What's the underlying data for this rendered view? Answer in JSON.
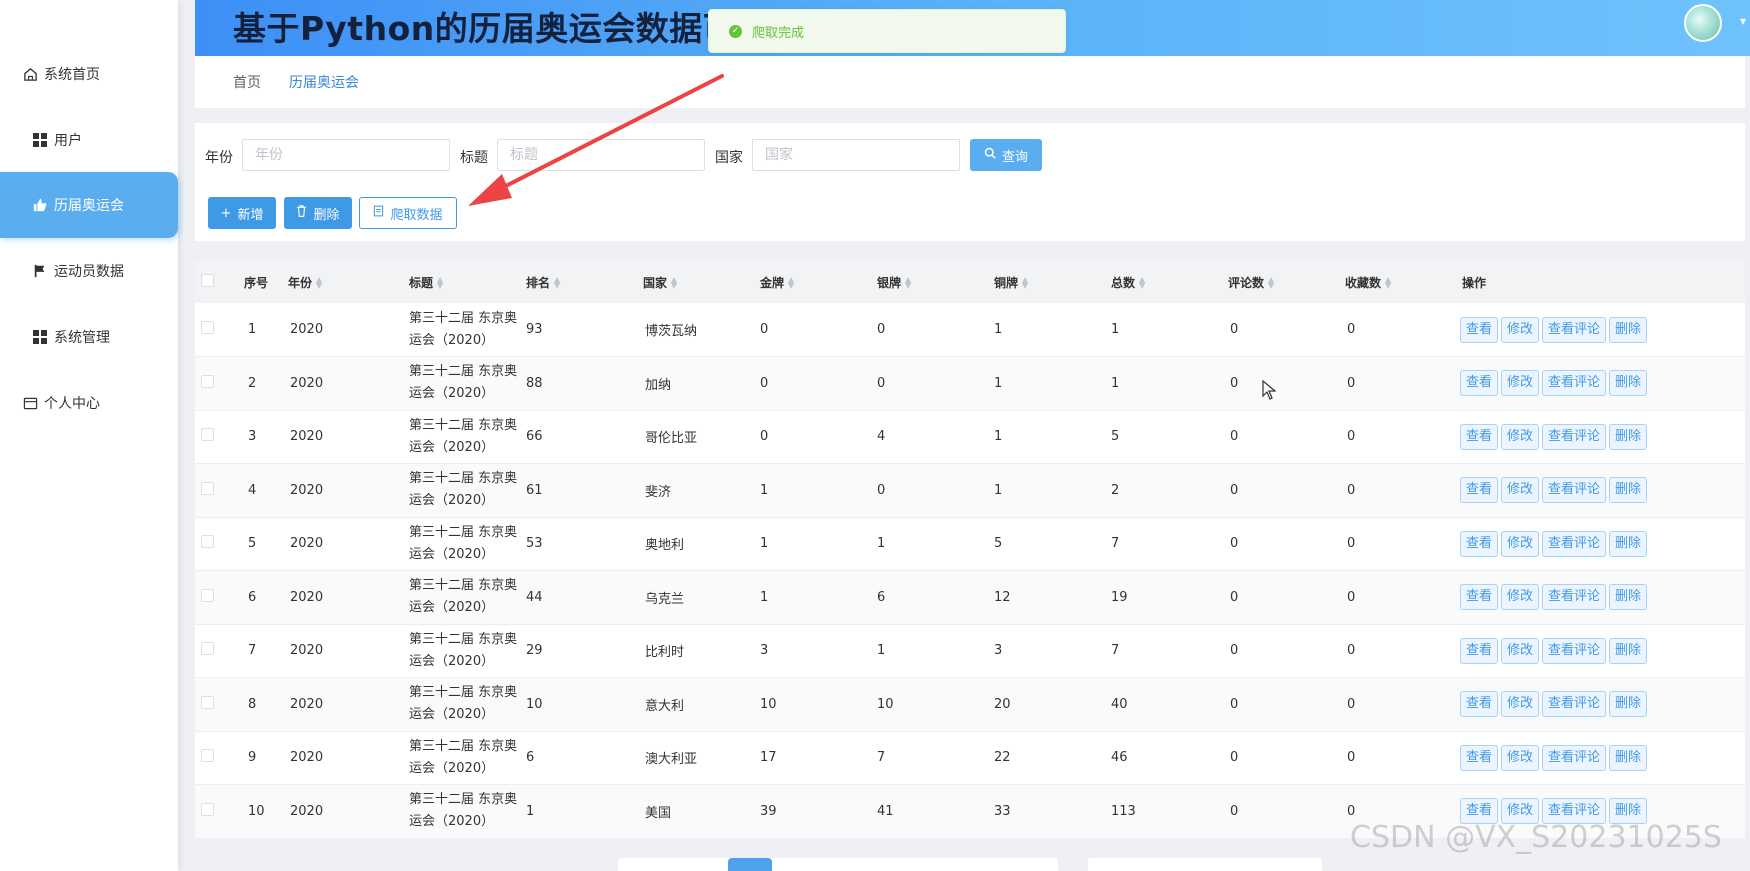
{
  "header": {
    "title": "基于Python的历届奥运会数据可视化分析系统"
  },
  "toast": {
    "message": "爬取完成"
  },
  "sidebar": {
    "items": [
      {
        "label": "系统首页",
        "icon": "home-icon"
      },
      {
        "label": "用户",
        "icon": "grid-icon"
      },
      {
        "label": "历届奥运会",
        "icon": "thumb-icon",
        "active": true
      },
      {
        "label": "运动员数据",
        "icon": "flag-icon"
      },
      {
        "label": "系统管理",
        "icon": "grid-icon"
      },
      {
        "label": "个人中心",
        "icon": "card-icon"
      }
    ]
  },
  "breadcrumb": {
    "home": "首页",
    "current": "历届奥运会"
  },
  "filters": {
    "year_label": "年份",
    "year_placeholder": "年份",
    "title_label": "标题",
    "title_placeholder": "标题",
    "country_label": "国家",
    "country_placeholder": "国家",
    "search_label": "查询"
  },
  "actions": {
    "add_label": "新增",
    "delete_label": "删除",
    "crawl_label": "爬取数据"
  },
  "table": {
    "headers": [
      "序号",
      "年份",
      "标题",
      "排名",
      "国家",
      "金牌",
      "银牌",
      "铜牌",
      "总数",
      "评论数",
      "收藏数",
      "操作"
    ],
    "row_actions": [
      "查看",
      "修改",
      "查看评论",
      "删除"
    ],
    "rows": [
      {
        "index": "1",
        "year": "2020",
        "title": "第三十二届 东京奥运会（2020）",
        "rank": "93",
        "country": "博茨瓦纳",
        "gold": "0",
        "silver": "0",
        "bronze": "1",
        "total": "1",
        "comments": "0",
        "favorites": "0"
      },
      {
        "index": "2",
        "year": "2020",
        "title": "第三十二届 东京奥运会（2020）",
        "rank": "88",
        "country": "加纳",
        "gold": "0",
        "silver": "0",
        "bronze": "1",
        "total": "1",
        "comments": "0",
        "favorites": "0"
      },
      {
        "index": "3",
        "year": "2020",
        "title": "第三十二届 东京奥运会（2020）",
        "rank": "66",
        "country": "哥伦比亚",
        "gold": "0",
        "silver": "4",
        "bronze": "1",
        "total": "5",
        "comments": "0",
        "favorites": "0"
      },
      {
        "index": "4",
        "year": "2020",
        "title": "第三十二届 东京奥运会（2020）",
        "rank": "61",
        "country": "斐济",
        "gold": "1",
        "silver": "0",
        "bronze": "1",
        "total": "2",
        "comments": "0",
        "favorites": "0"
      },
      {
        "index": "5",
        "year": "2020",
        "title": "第三十二届 东京奥运会（2020）",
        "rank": "53",
        "country": "奥地利",
        "gold": "1",
        "silver": "1",
        "bronze": "5",
        "total": "7",
        "comments": "0",
        "favorites": "0"
      },
      {
        "index": "6",
        "year": "2020",
        "title": "第三十二届 东京奥运会（2020）",
        "rank": "44",
        "country": "乌克兰",
        "gold": "1",
        "silver": "6",
        "bronze": "12",
        "total": "19",
        "comments": "0",
        "favorites": "0"
      },
      {
        "index": "7",
        "year": "2020",
        "title": "第三十二届 东京奥运会（2020）",
        "rank": "29",
        "country": "比利时",
        "gold": "3",
        "silver": "1",
        "bronze": "3",
        "total": "7",
        "comments": "0",
        "favorites": "0"
      },
      {
        "index": "8",
        "year": "2020",
        "title": "第三十二届 东京奥运会（2020）",
        "rank": "10",
        "country": "意大利",
        "gold": "10",
        "silver": "10",
        "bronze": "20",
        "total": "40",
        "comments": "0",
        "favorites": "0"
      },
      {
        "index": "9",
        "year": "2020",
        "title": "第三十二届 东京奥运会（2020）",
        "rank": "6",
        "country": "澳大利亚",
        "gold": "17",
        "silver": "7",
        "bronze": "22",
        "total": "46",
        "comments": "0",
        "favorites": "0"
      },
      {
        "index": "10",
        "year": "2020",
        "title": "第三十二届 东京奥运会（2020）",
        "rank": "1",
        "country": "美国",
        "gold": "39",
        "silver": "41",
        "bronze": "33",
        "total": "113",
        "comments": "0",
        "favorites": "0"
      }
    ]
  },
  "watermark": "CSDN @VX_S20231025S",
  "colors": {
    "accent": "#3f9ae6",
    "header_start": "#3d8ff5",
    "header_end": "#6fc2fb",
    "active_menu": "#5aaef0",
    "toast_text": "#67c23a"
  }
}
